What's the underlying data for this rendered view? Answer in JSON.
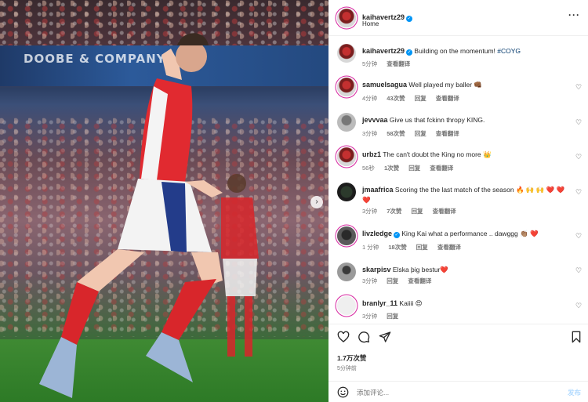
{
  "post": {
    "username": "kaihavertz29",
    "subtitle": "Home",
    "caption_text": "Building on the momentum! ",
    "caption_hashtag": "#COYG",
    "caption_time": "5分钟",
    "translate": "查看翻译",
    "likes": "1.7万次赞",
    "time_ago": "5分钟前",
    "add_comment_placeholder": "添加评论...",
    "post_label": "发布"
  },
  "photo": {
    "board_text": "DOOBE & COMPANY"
  },
  "comments": [
    {
      "user": "samuelsagua",
      "verified": false,
      "text": "Well played my baller 👊🏾",
      "time": "4分钟",
      "likes": "43次赞",
      "reply": "回复",
      "translate": "查看翻译"
    },
    {
      "user": "jevvvaa",
      "verified": false,
      "text": "Give us that fckinn thropy KING.",
      "time": "3分钟",
      "likes": "58次赞",
      "reply": "回复",
      "translate": "查看翻译"
    },
    {
      "user": "urbz1",
      "verified": false,
      "text": "The can't doubt the King no more 👑",
      "time": "56秒",
      "likes": "1次赞",
      "reply": "回复",
      "translate": "查看翻译"
    },
    {
      "user": "jmaafrica",
      "verified": false,
      "text": "Scoring the the last match of the season 🔥 🙌 🙌 ❤️ ❤️ ❤️",
      "time": "3分钟",
      "likes": "7次赞",
      "reply": "回复",
      "translate": "查看翻译"
    },
    {
      "user": "livzledge",
      "verified": true,
      "text": "King Kai what a performance .. dawggg 👏🏽 ❤️",
      "time": "1 分钟",
      "likes": "18次赞",
      "reply": "回复",
      "translate": "查看翻译"
    },
    {
      "user": "skarpisv",
      "verified": false,
      "text": "Elska þig bestur❤️",
      "time": "3分钟",
      "likes": "",
      "reply": "回复",
      "translate": "查看翻译"
    },
    {
      "user": "branlyr_11",
      "verified": false,
      "text": "Kaiiii 😍",
      "time": "3分钟",
      "likes": "",
      "reply": "回复",
      "translate": ""
    }
  ],
  "icons": {
    "heart": "heart-icon",
    "comment": "comment-icon",
    "share": "share-icon",
    "save": "bookmark-icon",
    "emoji": "emoji-icon",
    "more": "more-icon"
  },
  "colors": {
    "link": "#00376b",
    "verified": "#0095f6",
    "post_disabled": "#b3dbff"
  }
}
